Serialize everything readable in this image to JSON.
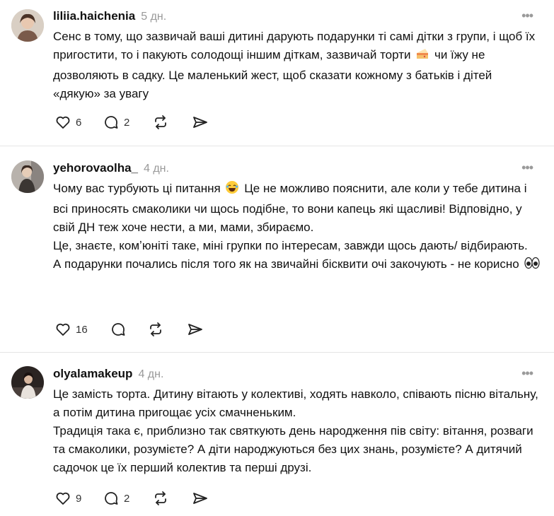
{
  "posts": [
    {
      "username": "liliia.haichenia",
      "time": "5 дн.",
      "paragraphs": [
        {
          "before": "Сенс в тому, що зазвичай ваші дитині дарують подарунки ті самі дітки з групи, і щоб їх пригостити, то і пакують солодощі іншим діткам, зазвичай торти",
          "emoji": "cake-emoji",
          "after": "чи їжу не дозволяють в садку. Це маленький жест, щоб сказати кожному з батьків і дітей «дякую» за увагу"
        }
      ],
      "likes": "6",
      "replies": "2"
    },
    {
      "username": "yehorovaolha_",
      "time": "4 дн.",
      "paragraphs": [
        {
          "before": "Чому вас турбують ці питання",
          "emoji": "laughing-emoji",
          "after": "Це не можливо пояснити, але коли у тебе дитина і всі приносять смаколики чи щось подібне, то вони капець які щасливі! Відповідно, у свій ДН теж хоче нести, а ми, мами, збираємо."
        },
        {
          "before": "Це, знаєте, комʼюніті таке, міні групки по інтересам, завжди щось дають/ відбирають."
        },
        {
          "before": "А подарунки почались після того як на звичайні бісквити очі закочують - не корисно",
          "emoji": "eyes-emoji"
        }
      ],
      "likes": "16",
      "replies": ""
    },
    {
      "username": "olyalamakeup",
      "time": "4 дн.",
      "paragraphs": [
        {
          "before": "Це замість торта. Дитину вітають у колективі, ходять навколо, співають пісню вітальну, а потім дитина пригощає усіх смачненьким."
        },
        {
          "before": "Традиція така є, приблизно так святкують день народження пів світу: вітання, розваги та смаколики, розумієте? А діти народжуються без цих знань, розумієте? А дитячий садочок це їх перший колектив та перші друзі."
        }
      ],
      "likes": "9",
      "replies": "2"
    }
  ],
  "more_label": "•••",
  "icons": [
    "heart-icon",
    "comment-icon",
    "repost-icon",
    "share-icon",
    "more-icon"
  ],
  "colors": {
    "muted": "#999999",
    "divider": "#e5e5e5",
    "text": "#111111"
  }
}
